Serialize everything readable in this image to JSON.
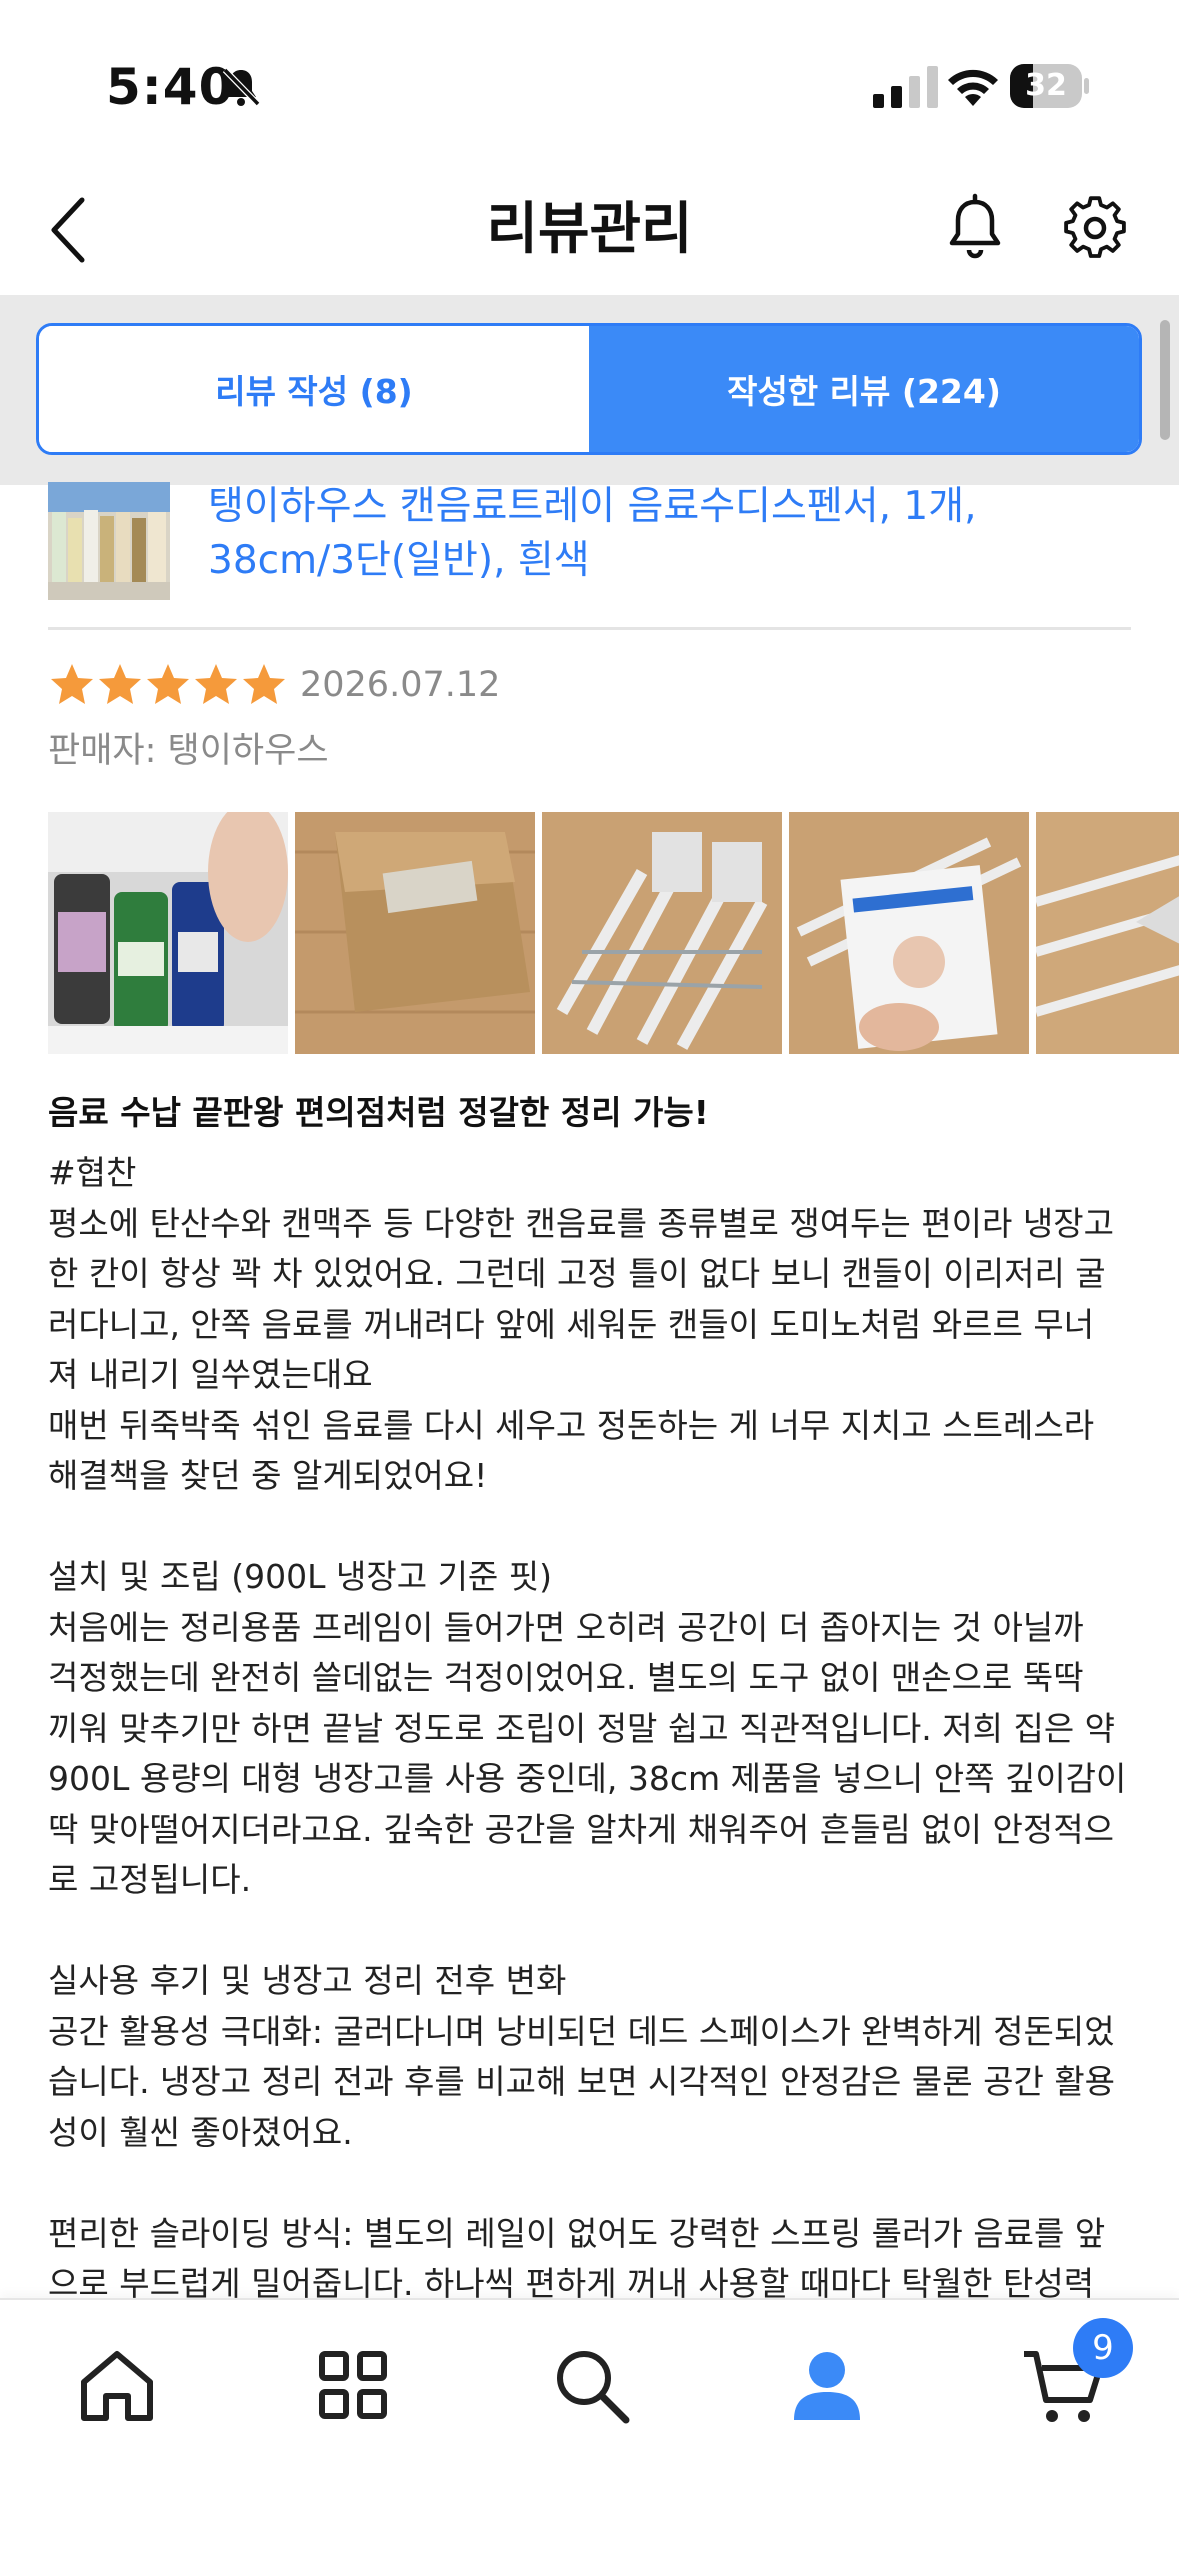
{
  "status_bar": {
    "time": "5:40",
    "battery_level": "32",
    "battery_fraction": 0.32
  },
  "header": {
    "title": "리뷰관리"
  },
  "tabs": [
    {
      "label": "리뷰 작성 (8)",
      "active": false
    },
    {
      "label": "작성한 리뷰 (224)",
      "active": true
    }
  ],
  "product": {
    "name_line1": "탱이하우스 캔음료트레이 음료수디스펜서, 1개,",
    "name_line2": "38cm/3단(일반), 흰색"
  },
  "review": {
    "rating": 5,
    "date": "2026.07.12",
    "seller": "판매자: 탱이하우스",
    "title": "음료 수납 끝판왕 편의점처럼 정갈한 정리 가능!",
    "body_lines": [
      "#협찬",
      "평소에 탄산수와 캔맥주 등 다양한 캔음료를 종류별로 쟁여두는 편이라 냉장고",
      "한 칸이 항상 꽉 차 있었어요. 그런데 고정 틀이 없다 보니 캔들이 이리저리 굴",
      "러다니고, 안쪽 음료를 꺼내려다 앞에 세워둔 캔들이 도미노처럼 와르르 무너",
      "져 내리기 일쑤였는대요",
      "매번 뒤죽박죽 섞인 음료를 다시 세우고 정돈하는 게 너무 지치고 스트레스라",
      "해결책을 찾던 중 알게되었어요!",
      "",
      " 설치 및 조립 (900L 냉장고 기준 핏)",
      "처음에는 정리용품 프레임이 들어가면 오히려 공간이 더 좁아지는 것 아닐까",
      "걱정했는데 완전히 쓸데없는 걱정이었어요. 별도의 도구 없이 맨손으로 뚝딱",
      "끼워 맞추기만 하면 끝날 정도로 조립이 정말 쉽고 직관적입니다. 저희 집은 약",
      "900L 용량의 대형 냉장고를 사용 중인데, 38cm 제품을 넣으니 안쪽 깊이감이",
      "딱 맞아떨어지더라고요. 깊숙한 공간을 알차게 채워주어 흔들림 없이 안정적으",
      "로 고정됩니다.",
      "",
      " 실사용 후기 및 냉장고 정리 전후 변화",
      "공간 활용성 극대화: 굴러다니며 낭비되던 데드 스페이스가 완벽하게 정돈되었",
      "습니다. 냉장고 정리 전과 후를 비교해 보면 시각적인 안정감은 물론 공간 활용",
      "성이 훨씬 좋아졌어요.",
      "",
      "편리한 슬라이딩 방식: 별도의 레일이 없어도 강력한 스프링 롤러가 음료를 앞",
      "으로 부드럽게 밀어줍니다. 하나씩 편하게 꺼내 사용할 때마다 탁월한 탄성력"
    ]
  },
  "bottom_nav": {
    "items": [
      "home-icon",
      "grid-icon",
      "search-icon",
      "user-icon",
      "cart-icon"
    ],
    "cart_count": "9",
    "active_item": "user-icon"
  },
  "colors": {
    "accent": "#2e7cf6",
    "star": "#f59a3b",
    "muted": "#8a8a8a"
  }
}
